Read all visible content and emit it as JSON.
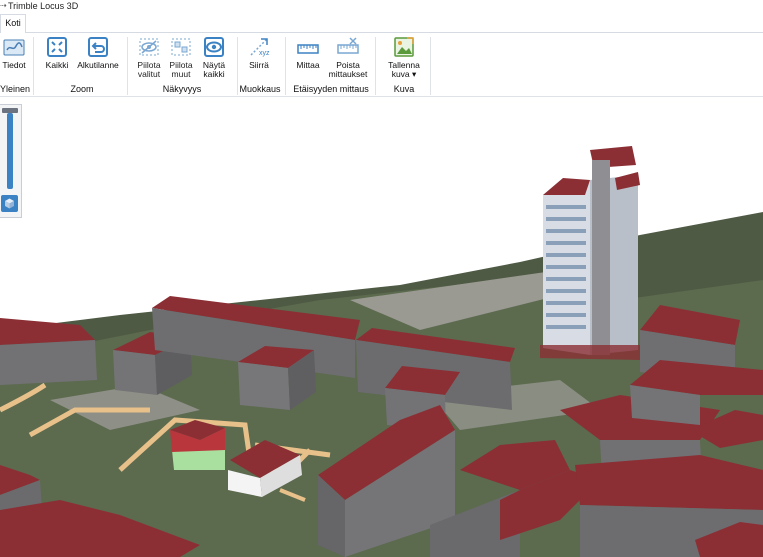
{
  "window": {
    "title": "Trimble Locus 3D"
  },
  "tabs": [
    {
      "label": "Koti",
      "active": true
    }
  ],
  "ribbon": {
    "groups": [
      {
        "name": "Yleinen",
        "buttons": [
          {
            "label": "Tiedot",
            "icon": "info-icon"
          }
        ]
      },
      {
        "name": "Zoom",
        "buttons": [
          {
            "label": "Kaikki",
            "icon": "zoom-extents-icon"
          },
          {
            "label": "Alkutilanne",
            "icon": "undo-view-icon"
          }
        ]
      },
      {
        "name": "Näkyvyys",
        "buttons": [
          {
            "label": "Piilota valitut",
            "icon": "hide-selected-icon"
          },
          {
            "label": "Piilota muut",
            "icon": "hide-others-icon"
          },
          {
            "label": "Näytä kaikki",
            "icon": "show-all-icon"
          }
        ]
      },
      {
        "name": "Muokkaus",
        "buttons": [
          {
            "label": "Siirrä",
            "icon": "move-xyz-icon"
          }
        ]
      },
      {
        "name": "Etäisyyden mittaus",
        "buttons": [
          {
            "label": "Mittaa",
            "icon": "measure-icon"
          },
          {
            "label": "Poista mittaukset",
            "icon": "delete-measurements-icon"
          }
        ]
      },
      {
        "name": "Kuva",
        "buttons": [
          {
            "label": "Tallenna kuva ▾",
            "icon": "save-image-icon"
          }
        ]
      }
    ]
  },
  "colors": {
    "accent": "#3b82c4",
    "roof": "#8b2f35",
    "wall": "#6e6e70",
    "sky": "#ffffff"
  }
}
